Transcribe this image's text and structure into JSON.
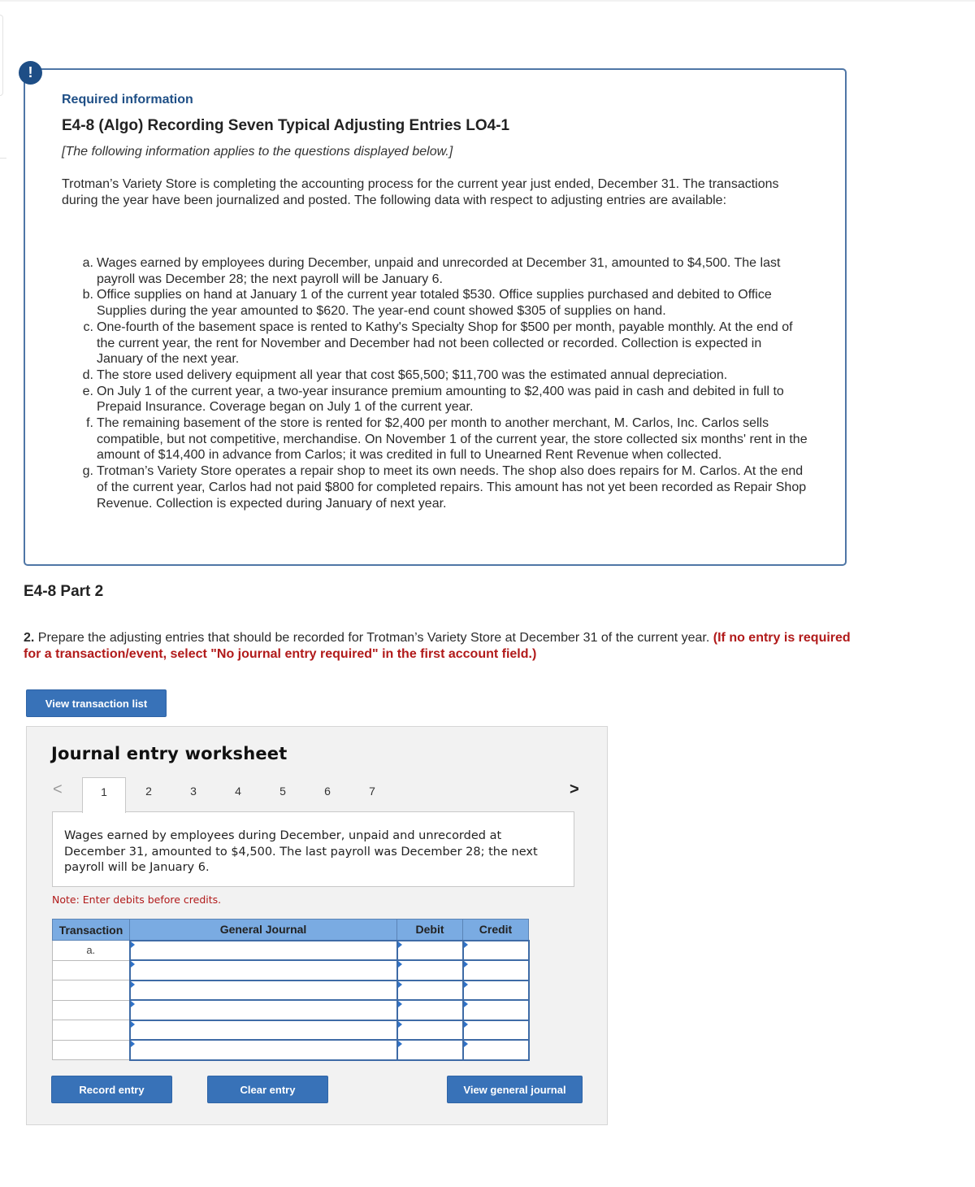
{
  "required_info": {
    "badge_icon": "exclamation-icon",
    "badge_glyph": "!",
    "label": "Required information",
    "exercise_title": "E4-8 (Algo) Recording Seven Typical Adjusting Entries LO4-1",
    "applies_note": "[The following information applies to the questions displayed below.]",
    "intro": "Trotman’s Variety Store is completing the accounting process for the current year just ended, December 31. The transactions during the year have been journalized and posted. The following data with respect to adjusting entries are available:",
    "items": [
      {
        "label": "a.",
        "text": "Wages earned by employees during December, unpaid and unrecorded at December 31, amounted to $4,500. The last payroll was December 28; the next payroll will be January 6."
      },
      {
        "label": "b.",
        "text": "Office supplies on hand at January 1 of the current year totaled $530. Office supplies purchased and debited to Office Supplies during the year amounted to $620. The year-end count showed $305 of supplies on hand."
      },
      {
        "label": "c.",
        "text": "One-fourth of the basement space is rented to Kathy's Specialty Shop for $500 per month, payable monthly. At the end of the current year, the rent for November and December had not been collected or recorded. Collection is expected in January of the next year."
      },
      {
        "label": "d.",
        "text": "The store used delivery equipment all year that cost $65,500; $11,700 was the estimated annual depreciation."
      },
      {
        "label": "e.",
        "text": "On July 1 of the current year, a two-year insurance premium amounting to $2,400 was paid in cash and debited in full to Prepaid Insurance. Coverage began on July 1 of the current year."
      },
      {
        "label": "f.",
        "text": "The remaining basement of the store is rented for $2,400 per month to another merchant, M. Carlos, Inc. Carlos sells compatible, but not competitive, merchandise. On November 1 of the current year, the store collected six months' rent in the amount of $14,400 in advance from Carlos; it was credited in full to Unearned Rent Revenue when collected."
      },
      {
        "label": "g.",
        "text": "Trotman’s Variety Store operates a repair shop to meet its own needs. The shop also does repairs for M. Carlos. At the end of the current year, Carlos had not paid $800 for completed repairs. This amount has not yet been recorded as Repair Shop Revenue. Collection is expected during January of next year."
      }
    ]
  },
  "part": {
    "title": "E4-8 Part 2",
    "question_number": "2.",
    "question_text": " Prepare the adjusting entries that should be recorded for Trotman’s Variety Store at December 31 of the current year. ",
    "question_instruction": "(If no entry is required for a transaction/event, select \"No journal entry required\" in the first account field.)",
    "view_transaction_list_label": "View transaction list"
  },
  "worksheet": {
    "title": "Journal entry worksheet",
    "prev_icon": "chevron-left-icon",
    "prev_glyph": "<",
    "next_icon": "chevron-right-icon",
    "next_glyph": ">",
    "tabs": [
      "1",
      "2",
      "3",
      "4",
      "5",
      "6",
      "7"
    ],
    "active_tab": "1",
    "description": "Wages earned by employees during December, unpaid and unrecorded at December 31, amounted to $4,500. The last payroll was December 28; the next payroll will be January 6.",
    "note": "Note: Enter debits before credits.",
    "table": {
      "headers": [
        "Transaction",
        "General Journal",
        "Debit",
        "Credit"
      ],
      "rows": [
        {
          "transaction": "a.",
          "account": "",
          "debit": "",
          "credit": ""
        },
        {
          "transaction": "",
          "account": "",
          "debit": "",
          "credit": ""
        },
        {
          "transaction": "",
          "account": "",
          "debit": "",
          "credit": ""
        },
        {
          "transaction": "",
          "account": "",
          "debit": "",
          "credit": ""
        },
        {
          "transaction": "",
          "account": "",
          "debit": "",
          "credit": ""
        },
        {
          "transaction": "",
          "account": "",
          "debit": "",
          "credit": ""
        }
      ]
    },
    "record_entry_label": "Record entry",
    "clear_entry_label": "Clear entry",
    "view_general_journal_label": "View general journal"
  },
  "colors": {
    "brand_blue": "#1f4f86",
    "button_blue": "#3872b8",
    "header_blue": "#7aabe2",
    "warning_red": "#b11a1a"
  }
}
